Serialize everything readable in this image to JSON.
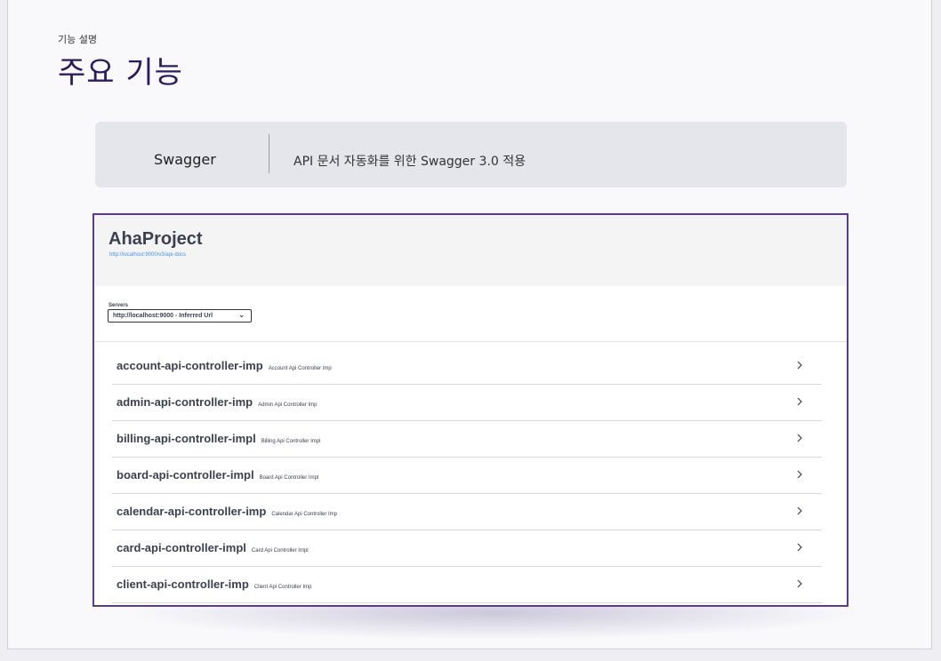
{
  "slide": {
    "eyebrow": "기능 설명",
    "heading": "주요 기능"
  },
  "feature": {
    "name": "Swagger",
    "description": "API 문서 자동화를 위한 Swagger 3.0 적용"
  },
  "swagger": {
    "title": "AhaProject",
    "url": "http://localhost:9000/v3/api-docs",
    "servers_label": "Servers",
    "servers_selected": "http://localhost:9000 - Inferred Url",
    "tags": [
      {
        "name": "account-api-controller-imp",
        "description": "Account Api Controller Imp"
      },
      {
        "name": "admin-api-controller-imp",
        "description": "Admin Api Controller Imp"
      },
      {
        "name": "billing-api-controller-impl",
        "description": "Billing Api Controller Impl"
      },
      {
        "name": "board-api-controller-impl",
        "description": "Board Api Controller Impl"
      },
      {
        "name": "calendar-api-controller-imp",
        "description": "Calendar Api Controller Imp"
      },
      {
        "name": "card-api-controller-impl",
        "description": "Card Api Controller Impl"
      },
      {
        "name": "client-api-controller-imp",
        "description": "Client Api Controller Imp"
      }
    ]
  },
  "colors": {
    "heading": "#2e1b5e",
    "frame_border": "#5a3c8e",
    "link": "#4990e2",
    "text": "#3b4151"
  },
  "icons": {
    "row_expand": "chevron-right-icon",
    "select_dropdown": "chevron-down-icon"
  }
}
